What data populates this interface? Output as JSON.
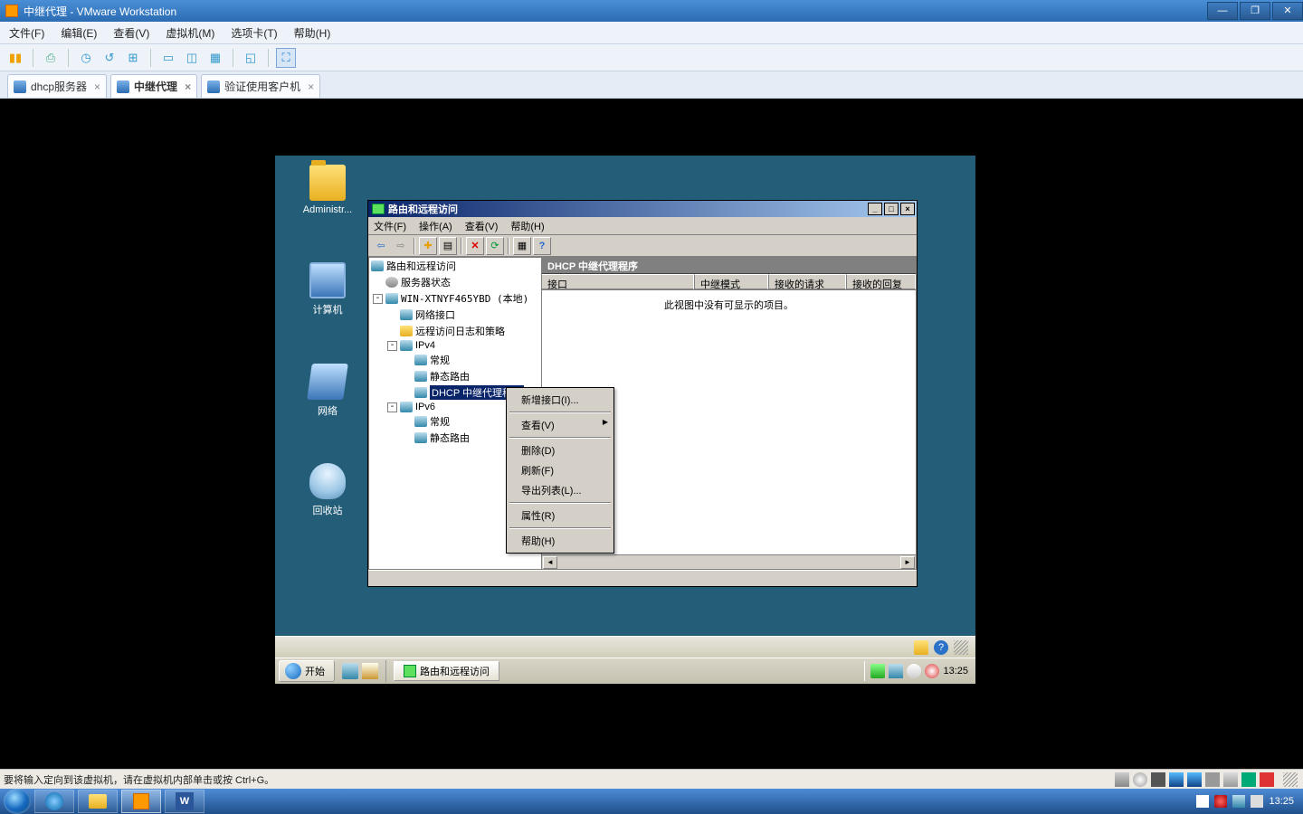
{
  "vmware": {
    "title": "中继代理 - VMware Workstation",
    "menu": [
      "文件(F)",
      "编辑(E)",
      "查看(V)",
      "虚拟机(M)",
      "选项卡(T)",
      "帮助(H)"
    ],
    "tabs": [
      {
        "label": "dhcp服务器",
        "active": false
      },
      {
        "label": "中继代理",
        "active": true
      },
      {
        "label": "验证使用客户机",
        "active": false
      }
    ],
    "status": "要将输入定向到该虚拟机，请在虚拟机内部单击或按 Ctrl+G。"
  },
  "guest_icons": {
    "admin": "Administr...",
    "computer": "计算机",
    "network": "网络",
    "recycle": "回收站"
  },
  "rras": {
    "title": "路由和远程访问",
    "menu": [
      "文件(F)",
      "操作(A)",
      "查看(V)",
      "帮助(H)"
    ],
    "tree": {
      "root": "路由和远程访问",
      "status": "服务器状态",
      "server": "WIN-XTNYF465YBD (本地)",
      "n1": "网络接口",
      "n2": "远程访问日志和策略",
      "ipv4": "IPv4",
      "ipv4_a": "常规",
      "ipv4_b": "静态路由",
      "ipv4_c": "DHCP 中继代理程序",
      "ipv6": "IPv6",
      "ipv6_a": "常规",
      "ipv6_b": "静态路由"
    },
    "right_title": "DHCP 中继代理程序",
    "cols": [
      "接口",
      "中继模式",
      "接收的请求",
      "接收的回复"
    ],
    "empty": "此视图中没有可显示的项目。"
  },
  "context_menu": [
    "新增接口(I)...",
    "查看(V)",
    "删除(D)",
    "刷新(F)",
    "导出列表(L)...",
    "属性(R)",
    "帮助(H)"
  ],
  "server_taskbar": {
    "start": "开始",
    "task": "路由和远程访问",
    "clock": "13:25"
  },
  "host_taskbar": {
    "clock": "13:25"
  }
}
